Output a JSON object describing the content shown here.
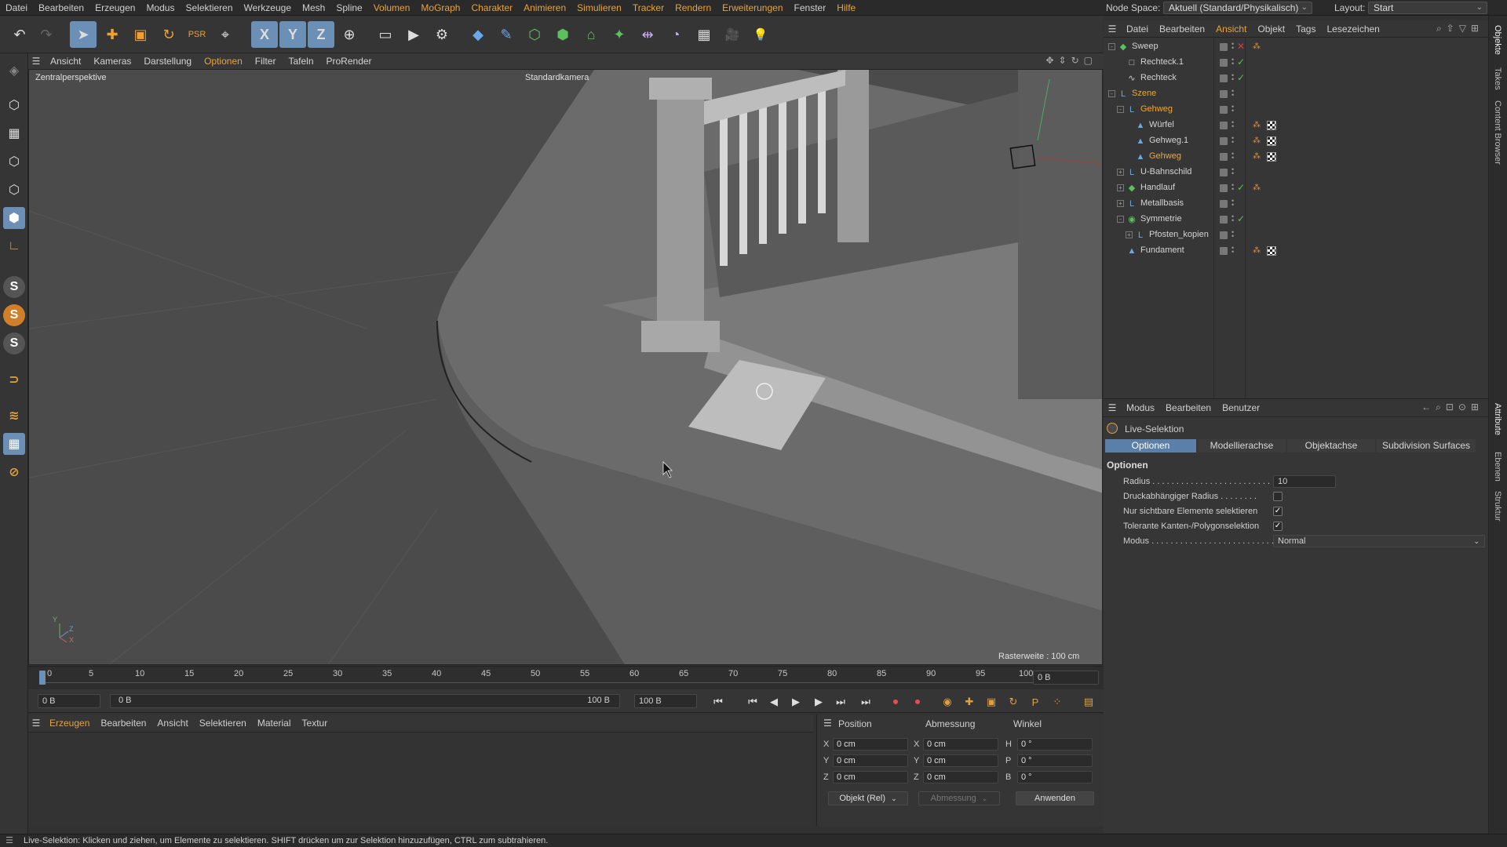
{
  "menubar": {
    "items": [
      "Datei",
      "Bearbeiten",
      "Erzeugen",
      "Modus",
      "Selektieren",
      "Werkzeuge",
      "Mesh",
      "Spline",
      "Volumen",
      "MoGraph",
      "Charakter",
      "Animieren",
      "Simulieren",
      "Tracker",
      "Rendern",
      "Erweiterungen",
      "Fenster",
      "Hilfe"
    ],
    "node_space_label": "Node Space:",
    "node_space_value": "Aktuell (Standard/Physikalisch)",
    "layout_label": "Layout:",
    "layout_value": "Start"
  },
  "toolbar": {
    "icons": [
      "undo-icon",
      "redo-icon",
      "live-selection-icon",
      "move-icon",
      "scale-icon",
      "rotate-icon",
      "psr-icon",
      "last-tool-icon",
      "x-axis-icon",
      "y-axis-icon",
      "z-axis-icon",
      "world-coords-icon",
      "render-region-icon",
      "render-view-icon",
      "render-settings-icon",
      "cube-icon",
      "pen-icon",
      "subdivision-icon",
      "array-icon",
      "deformer-icon",
      "generator-icon",
      "symmetry-icon",
      "field-icon",
      "floor-icon",
      "camera-icon",
      "light-icon"
    ],
    "glyphs": [
      "↶",
      "↷",
      "➤",
      "✚",
      "▣",
      "↻",
      "PSR",
      "⌖",
      "X",
      "Y",
      "Z",
      "⊕",
      "▭",
      "▶",
      "⚙",
      "◆",
      "✎",
      "⬡",
      "⬢",
      "⌂",
      "✦",
      "⇹",
      "◔",
      "▦",
      "🎥",
      "💡"
    ]
  },
  "viewport": {
    "menu": [
      "Ansicht",
      "Kameras",
      "Darstellung",
      "Optionen",
      "Filter",
      "Tafeln",
      "ProRender"
    ],
    "active_menu": "Optionen",
    "perspective_label": "Zentralperspektive",
    "camera_label": "Standardkamera",
    "grid_label": "Rasterweite : 100 cm"
  },
  "timeline": {
    "ticks": [
      "0",
      "5",
      "10",
      "15",
      "20",
      "25",
      "30",
      "35",
      "40",
      "45",
      "50",
      "55",
      "60",
      "65",
      "70",
      "75",
      "80",
      "85",
      "90",
      "95",
      "100"
    ],
    "current_frame_right": "0 B",
    "start_field": "0 B",
    "range_start": "0 B",
    "range_end": "100 B",
    "end_field": "100 B"
  },
  "material_manager": {
    "menu": [
      "Erzeugen",
      "Bearbeiten",
      "Ansicht",
      "Selektieren",
      "Material",
      "Textur"
    ]
  },
  "coordinates": {
    "headers": [
      "Position",
      "Abmessung",
      "Winkel"
    ],
    "rows": [
      {
        "axis": "X",
        "pos": "0 cm",
        "size_axis": "X",
        "size": "0 cm",
        "rot_axis": "H",
        "rot": "0 °"
      },
      {
        "axis": "Y",
        "pos": "0 cm",
        "size_axis": "Y",
        "size": "0 cm",
        "rot_axis": "P",
        "rot": "0 °"
      },
      {
        "axis": "Z",
        "pos": "0 cm",
        "size_axis": "Z",
        "size": "0 cm",
        "rot_axis": "B",
        "rot": "0 °"
      }
    ],
    "mode_dropdown": "Objekt (Rel)",
    "size_dropdown": "Abmessung",
    "apply_button": "Anwenden"
  },
  "object_manager": {
    "menu": [
      "Datei",
      "Bearbeiten",
      "Ansicht",
      "Objekt",
      "Tags",
      "Lesezeichen"
    ],
    "active_menu": "Ansicht",
    "objects": [
      {
        "name": "Sweep",
        "indent": 0,
        "expand": "-",
        "icon": "sweep-icon",
        "glyph": "◆",
        "color": "#5cc05c",
        "highlight": false,
        "check": "x",
        "tags": [
          "phong"
        ]
      },
      {
        "name": "Rechteck.1",
        "indent": 1,
        "expand": "",
        "icon": "rectangle-spline-icon",
        "glyph": "□",
        "color": "#cccccc",
        "highlight": false,
        "check": "v",
        "tags": []
      },
      {
        "name": "Rechteck",
        "indent": 1,
        "expand": "",
        "icon": "spline-icon",
        "glyph": "∿",
        "color": "#cccccc",
        "highlight": false,
        "check": "v",
        "tags": []
      },
      {
        "name": "Szene",
        "indent": 0,
        "expand": "-",
        "icon": "null-icon",
        "glyph": "L",
        "color": "#6aa8e8",
        "highlight": true,
        "check": "",
        "tags": []
      },
      {
        "name": "Gehweg",
        "indent": 1,
        "expand": "-",
        "icon": "null-icon",
        "glyph": "L",
        "color": "#6aa8e8",
        "highlight": true,
        "check": "",
        "tags": []
      },
      {
        "name": "Würfel",
        "indent": 2,
        "expand": "",
        "icon": "polygon-icon",
        "glyph": "▲",
        "color": "#6aa8e8",
        "highlight": false,
        "check": "",
        "tags": [
          "phong",
          "checker"
        ]
      },
      {
        "name": "Gehweg.1",
        "indent": 2,
        "expand": "",
        "icon": "polygon-icon",
        "glyph": "▲",
        "color": "#6aa8e8",
        "highlight": false,
        "check": "",
        "tags": [
          "phong",
          "checker"
        ]
      },
      {
        "name": "Gehweg",
        "indent": 2,
        "expand": "",
        "icon": "polygon-icon",
        "glyph": "▲",
        "color": "#6aa8e8",
        "highlight": true,
        "check": "",
        "tags": [
          "phong",
          "checker"
        ]
      },
      {
        "name": "U-Bahnschild",
        "indent": 1,
        "expand": "+",
        "icon": "null-icon",
        "glyph": "L",
        "color": "#6aa8e8",
        "highlight": false,
        "check": "",
        "tags": []
      },
      {
        "name": "Handlauf",
        "indent": 1,
        "expand": "+",
        "icon": "sweep-icon",
        "glyph": "◆",
        "color": "#5cc05c",
        "highlight": false,
        "check": "v",
        "tags": [
          "phong"
        ]
      },
      {
        "name": "Metallbasis",
        "indent": 1,
        "expand": "+",
        "icon": "null-icon",
        "glyph": "L",
        "color": "#6aa8e8",
        "highlight": false,
        "check": "",
        "tags": []
      },
      {
        "name": "Symmetrie",
        "indent": 1,
        "expand": "-",
        "icon": "symmetry-icon",
        "glyph": "◉",
        "color": "#5cc05c",
        "highlight": false,
        "check": "v",
        "tags": []
      },
      {
        "name": "Pfosten_kopien",
        "indent": 2,
        "expand": "+",
        "icon": "null-icon",
        "glyph": "L",
        "color": "#6aa8e8",
        "highlight": false,
        "check": "",
        "tags": []
      },
      {
        "name": "Fundament",
        "indent": 1,
        "expand": "",
        "icon": "polygon-icon",
        "glyph": "▲",
        "color": "#6aa8e8",
        "highlight": false,
        "check": "",
        "tags": [
          "phong",
          "checker"
        ]
      }
    ]
  },
  "attribute_manager": {
    "menu": [
      "Modus",
      "Bearbeiten",
      "Benutzer"
    ],
    "tool_name": "Live-Selektion",
    "tabs": [
      "Optionen",
      "Modellierachse",
      "Objektachse",
      "Subdivision Surfaces"
    ],
    "active_tab": "Optionen",
    "section_title": "Optionen",
    "params": [
      {
        "label": "Radius . . . . . . . . . . . . . . . . . . . . . . . . . .",
        "type": "number",
        "value": "10"
      },
      {
        "label": "Druckabhängiger Radius . . . . . . . .",
        "type": "checkbox",
        "checked": false
      },
      {
        "label": "Nur sichtbare Elemente selektieren",
        "type": "checkbox",
        "checked": true
      },
      {
        "label": "Tolerante Kanten-/Polygonselektion",
        "type": "checkbox",
        "checked": true
      },
      {
        "label": "Modus . . . . . . . . . . . . . . . . . . . . . . . . . . .",
        "type": "select",
        "value": "Normal"
      }
    ]
  },
  "side_tabs": [
    "Objekte",
    "Takes",
    "Content Browser",
    "Attribute",
    "Ebenen",
    "Struktur"
  ],
  "statusbar": {
    "text": "Live-Selektion: Klicken und ziehen, um Elemente zu selektieren. SHIFT drücken um zur Selektion hinzuzufügen, CTRL zum subtrahieren."
  },
  "colors": {
    "accent": "#e8a33a",
    "selection_blue": "#6c8fb6",
    "tab_active": "#5a7fa8"
  }
}
